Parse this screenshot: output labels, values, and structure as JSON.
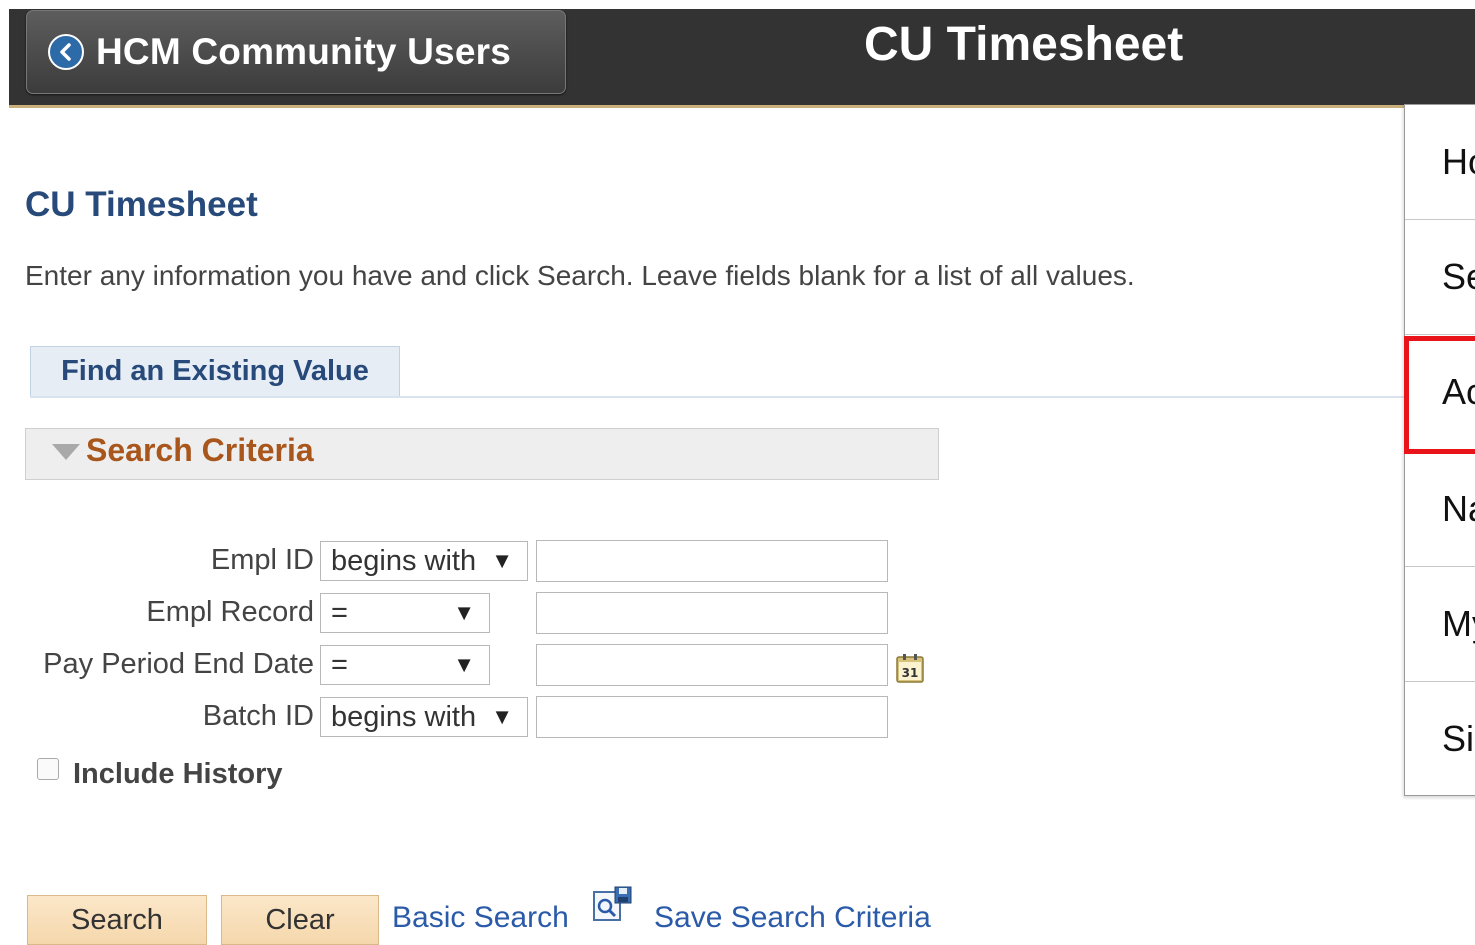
{
  "header": {
    "back_label": "HCM Community Users",
    "title": "CU Timesheet"
  },
  "page": {
    "heading": "CU Timesheet",
    "instructions": "Enter any information you have and click Search. Leave fields blank for a list of all values."
  },
  "tabs": [
    {
      "label": "Find an Existing Value"
    }
  ],
  "search_criteria": {
    "title": "Search Criteria",
    "fields": [
      {
        "label": "Empl ID",
        "operator": "begins with",
        "value": ""
      },
      {
        "label": "Empl Record",
        "operator": "=",
        "value": ""
      },
      {
        "label": "Pay Period End Date",
        "operator": "=",
        "value": ""
      },
      {
        "label": "Batch ID",
        "operator": "begins with",
        "value": ""
      }
    ],
    "include_history_label": "Include History",
    "include_history_checked": false
  },
  "actions": {
    "search": "Search",
    "clear": "Clear",
    "basic_search": "Basic Search",
    "save_search_criteria": "Save Search Criteria"
  },
  "actions_menu": {
    "items": [
      "Ho",
      "Se",
      "Ac",
      "Na",
      "My",
      "Si"
    ],
    "highlighted_index": 2
  },
  "colors": {
    "header_bg": "#333333",
    "heading": "#274a7a",
    "criteria_title": "#a8561b",
    "link": "#2a5aa8",
    "highlight": "#e8141a"
  }
}
